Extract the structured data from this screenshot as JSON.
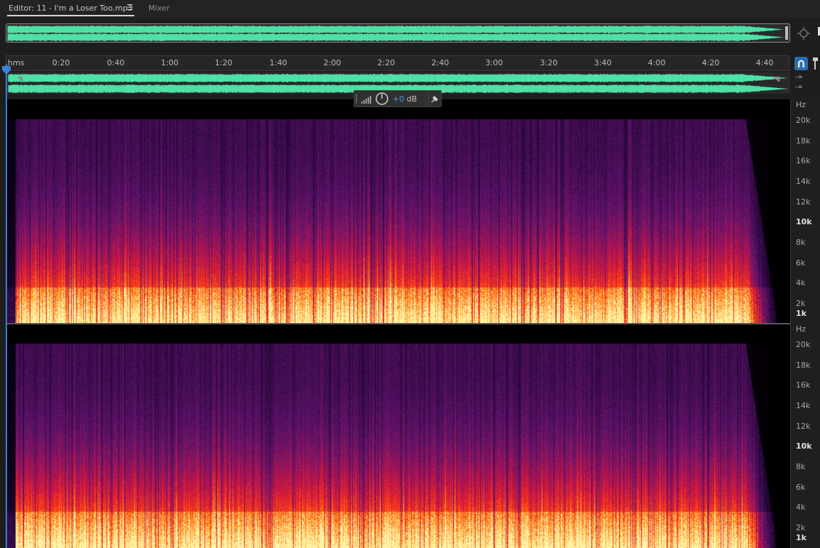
{
  "tabs": {
    "editor_label": "Editor: 11 - I'm a Loser Too.mp3",
    "menu_glyph": "☰",
    "mixer_label": "Mixer"
  },
  "timeline": {
    "format_label": "hms",
    "ticks": [
      "0:20",
      "0:40",
      "1:00",
      "1:20",
      "1:40",
      "2:00",
      "2:20",
      "2:40",
      "3:00",
      "3:20",
      "3:40",
      "4:00",
      "4:20",
      "4:40"
    ]
  },
  "levels": {
    "ch1": "-∞",
    "ch2": "-∞"
  },
  "hud": {
    "gain_value": "+0",
    "gain_unit": "dB"
  },
  "frequency_axis": {
    "unit": "Hz",
    "labels": [
      "20k",
      "18k",
      "16k",
      "14k",
      "12k",
      "10k",
      "8k",
      "6k",
      "4k",
      "2k",
      "1k"
    ]
  },
  "colors": {
    "waveform": "#4fe0a6",
    "accent_blue": "#3b7fd8",
    "spectral_low": "#fff0a0",
    "spectral_mid": "#ff3b1a",
    "spectral_high": "#6a1a7a"
  },
  "icons": {
    "zoom_navigator": "zoom-navigator-icon",
    "snap": "magnet-icon",
    "marker": "marker-icon",
    "playhead": "playhead-icon",
    "hud_meter": "level-meter-icon",
    "hud_knob": "volume-knob-icon",
    "hud_pin": "pin-icon"
  }
}
